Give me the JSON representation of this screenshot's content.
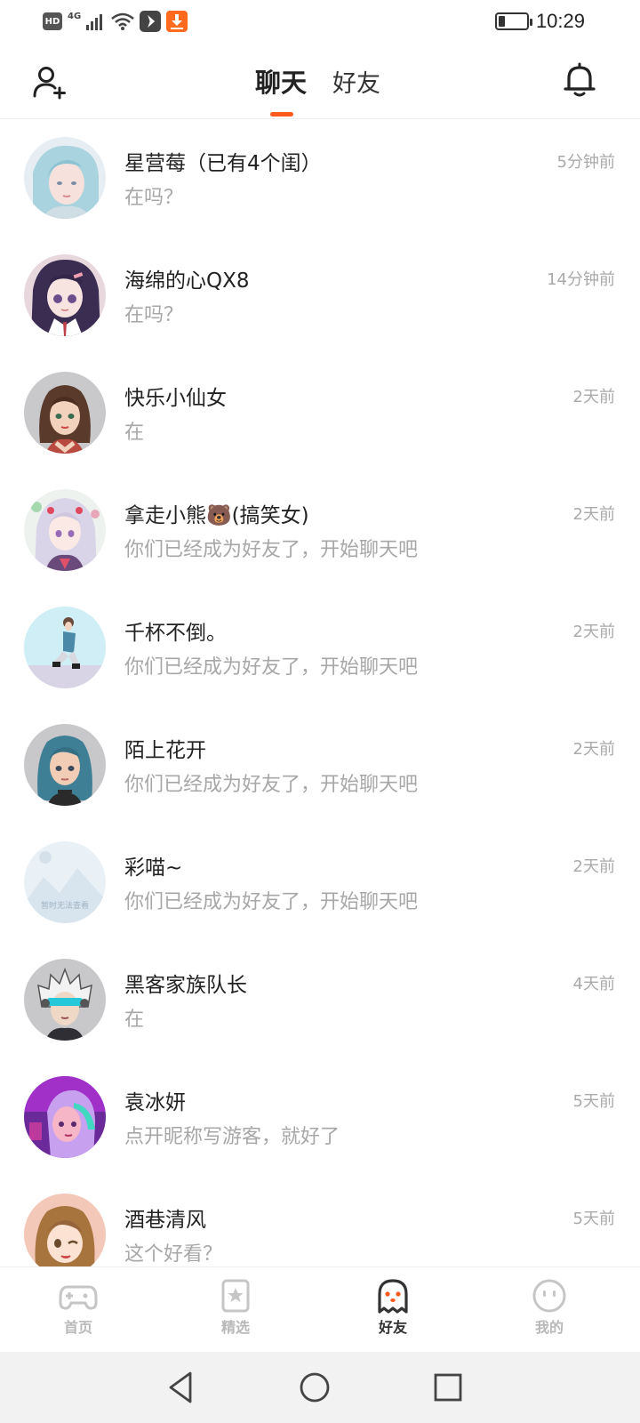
{
  "status_bar": {
    "hd": "HD",
    "network": "4G",
    "time": "10:29"
  },
  "header": {
    "tabs": [
      {
        "label": "聊天",
        "active": true
      },
      {
        "label": "好友",
        "active": false
      }
    ],
    "accent_color": "#ff5a1e"
  },
  "chats": [
    {
      "name": "星营莓（已有4个闺）",
      "message": "在吗？",
      "time": "5分钟前",
      "avatar": "anime-girl-blue-hair"
    },
    {
      "name": "海绵的心QX8",
      "message": "在吗？",
      "time": "14分钟前",
      "avatar": "anime-girl-dark-hair"
    },
    {
      "name": "快乐小仙女",
      "message": "在",
      "time": "2天前",
      "avatar": "girl-brown-hair"
    },
    {
      "name": "拿走小熊🐻(搞笑女)",
      "message": "你们已经成为好友了，开始聊天吧",
      "time": "2天前",
      "avatar": "anime-girl-silver-hair"
    },
    {
      "name": "千杯不倒。",
      "message": "你们已经成为好友了，开始聊天吧",
      "time": "2天前",
      "avatar": "sitting-figure"
    },
    {
      "name": "陌上花开",
      "message": "你们已经成为好友了，开始聊天吧",
      "time": "2天前",
      "avatar": "girl-teal-hair"
    },
    {
      "name": "彩喵~",
      "message": "你们已经成为好友了，开始聊天吧",
      "time": "2天前",
      "avatar": "image-unavailable",
      "avatar_text": "暂时无法查看"
    },
    {
      "name": "黑客家族队长",
      "message": "在",
      "time": "4天前",
      "avatar": "boy-visor"
    },
    {
      "name": "袁冰妍",
      "message": "点开昵称写游客，就好了",
      "time": "5天前",
      "avatar": "purple-hair-girl"
    },
    {
      "name": "酒巷清风",
      "message": "这个好看？",
      "time": "5天前",
      "avatar": "anime-girl-winking"
    }
  ],
  "bottom_nav": [
    {
      "label": "首页",
      "icon": "gamepad-icon",
      "active": false
    },
    {
      "label": "精选",
      "icon": "star-badge-icon",
      "active": false
    },
    {
      "label": "好友",
      "icon": "ghost-icon",
      "active": true
    },
    {
      "label": "我的",
      "icon": "smiley-icon",
      "active": false
    }
  ]
}
